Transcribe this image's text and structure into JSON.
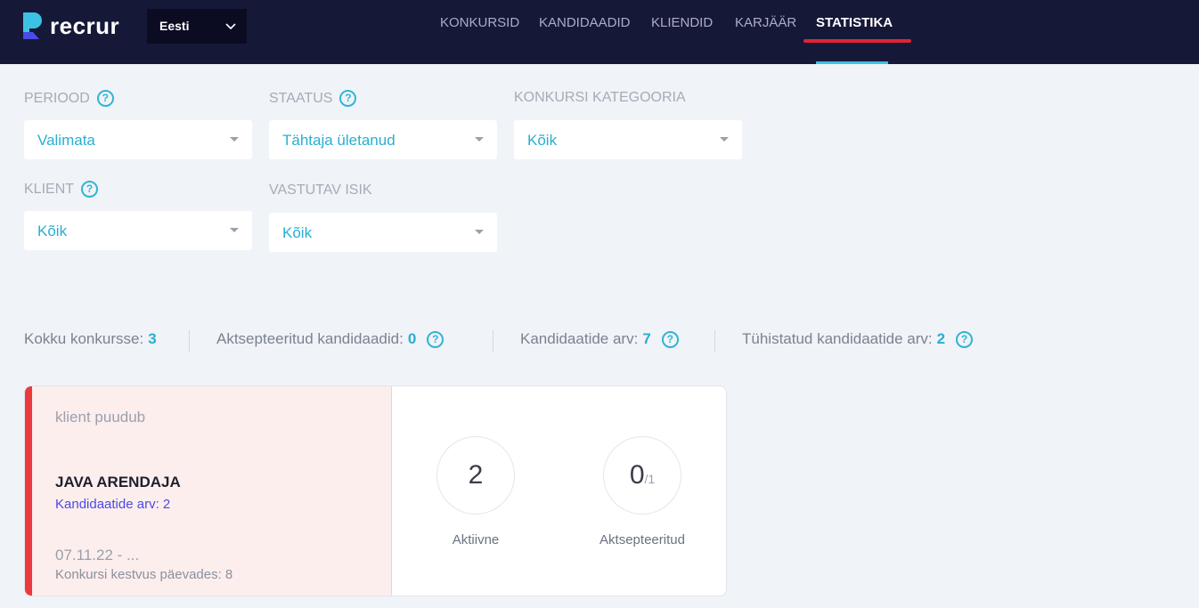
{
  "app": {
    "logo_text": "recrur",
    "language": "Eesti"
  },
  "nav": {
    "items": [
      "KONKURSID",
      "KANDIDAADID",
      "KLIENDID",
      "KARJÄÄR",
      "STATISTIKA"
    ],
    "active": "STATISTIKA"
  },
  "filters": {
    "period": {
      "label": "PERIOOD",
      "value": "Valimata"
    },
    "status": {
      "label": "STAATUS",
      "value": "Tähtaja ületanud"
    },
    "category": {
      "label": "KONKURSI KATEGOORIA",
      "value": "Kõik"
    },
    "client": {
      "label": "KLIENT",
      "value": "Kõik"
    },
    "responsible": {
      "label": "VASTUTAV ISIK",
      "value": "Kõik"
    }
  },
  "stats": {
    "total_label": "Kokku konkursse:",
    "total_value": "3",
    "accepted_label": "Aktsepteeritud kandidaadid:",
    "accepted_value": "0",
    "candidates_label": "Kandidaatide arv:",
    "candidates_value": "7",
    "cancelled_label": "Tühistatud kandidaatide arv:",
    "cancelled_value": "2"
  },
  "card": {
    "client": "klient puudub",
    "title": "JAVA ARENDAJA",
    "candidate_count": "Kandidaatide arv: 2",
    "dates": "07.11.22 - ...",
    "duration": "Konkursi kestvus päevades: 8",
    "active_value": "2",
    "active_label": "Aktiivne",
    "accepted_value": "0",
    "accepted_total": "/1",
    "accepted_label": "Aktsepteeritud"
  },
  "colors": {
    "topbar": "#161838",
    "accent": "#2aaed0",
    "nav_underline": "#e22434",
    "card_stripe": "#ea3a3f"
  }
}
